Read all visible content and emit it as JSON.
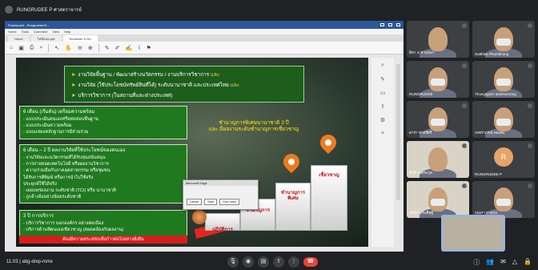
{
  "presenter": {
    "label": "RUNGRUDEE P ศาสตราจารย์"
  },
  "viewer": {
    "titlebar": "Powerpoint - RungruedeeS...",
    "menus": [
      "Home",
      "Tools",
      "Comment",
      "View",
      "Help"
    ],
    "tabs": [
      "Home",
      "ไฟล์แนบ.pdf",
      "Reviewer ระบบ"
    ],
    "active_tab": 2
  },
  "slide": {
    "header_lines": [
      {
        "text": "งานวิจัยพื้นฐาน / พัฒนาสร้างนวัตกรรม / งานบริการวิชาการ",
        "accent": "และ"
      },
      {
        "text": "งานวิจัย (ใช้ประโยชน์ทรัพย์สินที่ได้) ระดับนานาชาติ และประเทศไทย",
        "accent": "และ"
      },
      {
        "text": "บริการวิชาการ (ในสถานที่และต่างประเทศ)",
        "accent": ""
      }
    ],
    "box1": {
      "title": "6 เดือน (เริ่มต้น) เตรียมความพร้อม",
      "items": [
        "- แบบประเมินตนเองหรือทดสอบพื้นฐาน",
        "- แบบประเมินความพร้อม",
        "- แบบแสดงหลักฐานการมีส่วนร่วม"
      ]
    },
    "box2": {
      "title": "6 เดือน – 2 ปี ผลงานวิจัยที่ใช้ประโยชน์ของตนเอง",
      "items": [
        "- งานวิจัยและนวัตกรรมที่ได้รับทุนสนับสนุน",
        "- การถ่ายทอดเทคโนโลยี หรือผลงานวิชาการ",
        "- ความร่วมมือกับภาคอุตสาหกรรม หรือชุมชน",
        "  ได้รับการตีพิมพ์ หรือการนำไปใช้จริง",
        "  ประยุกต์ใช้ได้จริง",
        "- เผยแพร่ผลงาน ระดับชาติ (TCI) หรือ นานาชาติ",
        "- ถูกอ้างอิงอย่างน้อยระดับชาติ"
      ]
    },
    "box3": {
      "title": "3 ปี การบริการ",
      "items": [
        "- บริการวิชาการ นอกองค์กร อย่างต่อเนื่อง",
        "- บริการด้านที่ตนเองเชี่ยวชาญ (สอดคล้องกับผลงาน)"
      ]
    },
    "redbar": "ต้องมีความตระหนักเพื่อก้าวต่อไปอย่างยั่งยืน",
    "caption": {
      "line1": "ชำนาญการพิเศษนานาชาติ 3 ปี",
      "line2": "และ มีผลงานระดับชำนาญการเชี่ยวชาญ"
    },
    "steps": [
      "ปฏิบัติการ",
      "ชำนาญการ",
      "ชำนาญการพิเศษ",
      "เชี่ยวชาญ"
    ],
    "dialog": {
      "title": "Microsoft Edge",
      "buttons": [
        "Cancel",
        "Save",
        "Don't save"
      ]
    }
  },
  "participants": [
    {
      "name": "ดิลา ๔ ศานจนา",
      "style": "photo",
      "mask": false
    },
    {
      "name": "Sutthisa Phumkhong",
      "style": "photo",
      "mask": true
    },
    {
      "name": "RUNGRUDEE",
      "style": "photo",
      "mask": true
    },
    {
      "name": "Thunyaporn asoksumong",
      "style": "photo",
      "mask": true
    },
    {
      "name": "ดารา ชาตรีศรี",
      "style": "photo",
      "mask": true
    },
    {
      "name": "เพชราภรณ์ พลเสน",
      "style": "photo",
      "mask": true
    },
    {
      "name": "ศักดิ์ ลาตระกุล",
      "style": "bright",
      "mask": false
    },
    {
      "name": "RUNGRUDEE P",
      "style": "photo",
      "mask": false
    },
    {
      "name": "ปวีณา ประดิษฐ์",
      "style": "bright",
      "mask": true
    },
    {
      "name": "กุณภา ภาสกุล",
      "style": "photo",
      "mask": true
    }
  ],
  "meeting": {
    "time": "11:03",
    "code": "abg-dnqi-mmx"
  },
  "colors": {
    "meet_bg": "#202124",
    "end_call": "#ea4335",
    "slide_green": "#1f7a1f",
    "slide_red": "#d61e1e",
    "caption_yellow": "#ffe600"
  }
}
